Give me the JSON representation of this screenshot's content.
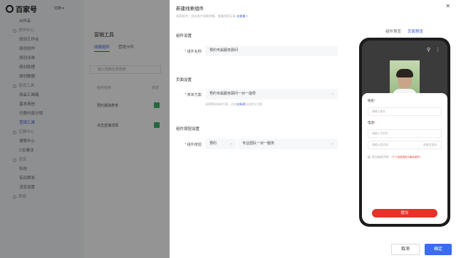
{
  "app": {
    "logo_text": "百家号",
    "switch_label": "切换"
  },
  "sidebar": {
    "items": [
      {
        "type": "item",
        "label": "AI作品"
      },
      {
        "type": "section",
        "label": "创作中心"
      },
      {
        "type": "item",
        "label": "原创工作台"
      },
      {
        "type": "item",
        "label": "原创创作"
      },
      {
        "type": "item",
        "label": "原创派单"
      },
      {
        "type": "item",
        "label": "原创助理"
      },
      {
        "type": "item",
        "label": "原创数据"
      },
      {
        "type": "section",
        "label": "变现工具"
      },
      {
        "type": "item",
        "label": "商品工具箱"
      },
      {
        "type": "item",
        "label": "基本商信"
      },
      {
        "type": "item",
        "label": "付费内容分销"
      },
      {
        "type": "item",
        "label": "营销工具",
        "active": true
      },
      {
        "type": "section",
        "label": "互推中心"
      },
      {
        "type": "item",
        "label": "搜索中心"
      },
      {
        "type": "item",
        "label": "C位看法"
      },
      {
        "type": "section",
        "label": "消息"
      },
      {
        "type": "item",
        "label": "私信"
      },
      {
        "type": "item",
        "label": "有目群发"
      },
      {
        "type": "item",
        "label": "消息设置"
      },
      {
        "type": "section",
        "label": "数据"
      }
    ]
  },
  "main": {
    "title": "营销工具",
    "tabs": [
      "线索组件",
      "营销卡件"
    ],
    "search_placeholder": "输入线索名称搜索",
    "columns": [
      "组件名称",
      "状态"
    ],
    "rows": [
      "预约基础表单",
      "点击直播详情"
    ]
  },
  "drawer": {
    "title": "新建线索组件",
    "close_icon": "close-icon",
    "description": "线索组件，会议用户线索收集，查看线索记录",
    "description_link": "去查看 >",
    "groups": {
      "settings": "组件设置",
      "page": "页面设置",
      "button": "组件按钮设置"
    },
    "fields": {
      "name_label": "组件名称:",
      "name_value": "预约专属服务顾问",
      "form_label": "表单方案:",
      "form_value": "预约专属服务顾问一对一指导",
      "form_hint": "选择预设表单方案，点击",
      "form_hint_link": "去新建",
      "form_hint_suffix": "去自定义方案",
      "button_label": "组件按钮:",
      "button_type": "预约",
      "button_text": "专业团队一对一服务"
    }
  },
  "preview": {
    "tabs": [
      "组件预览",
      "页面预览"
    ],
    "active_tab": 1,
    "top_icons": [
      "search-icon",
      "more-icon"
    ],
    "form": {
      "name_label": "姓名",
      "name_placeholder": "请输入姓名",
      "phone_label": "电话",
      "phone_placeholder": "请输入手机号",
      "code_placeholder": "请输入验证码",
      "code_action": "获取验证码",
      "agree_prefix": "我已阅读并同意",
      "agree_link": "《个人信息授权与隐私保护》",
      "submit": "提交"
    }
  },
  "footer": {
    "cancel": "取消",
    "ok": "确定"
  },
  "colors": {
    "accent": "#3a6bf0",
    "submit": "#e5332a",
    "required": "#e53935"
  }
}
